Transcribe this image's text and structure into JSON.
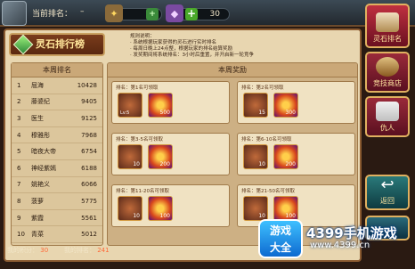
{
  "topbar": {
    "rank_label": "当前排名：",
    "rank_value": "–",
    "rank_badge": "8",
    "gems": "30"
  },
  "panel": {
    "title": "灵石排行榜",
    "rules": [
      "规则说明：",
      "· 系统根据玩家获得的灵石进行实时排名",
      "· 每周日晚上24点整，根据玩家的排名结算奖励",
      "· 发奖期间将系统排名：3小时后重置，并开启新一轮竞争"
    ],
    "left_header": "本周排名",
    "right_header": "本周奖励",
    "ranking": [
      {
        "num": "1",
        "name": "屈海",
        "score": "10428"
      },
      {
        "num": "2",
        "name": "藤婆纪",
        "score": "9405"
      },
      {
        "num": "3",
        "name": "医生",
        "score": "9125"
      },
      {
        "num": "4",
        "name": "穆雅彤",
        "score": "7968"
      },
      {
        "num": "5",
        "name": "暗夜大帝",
        "score": "6754"
      },
      {
        "num": "6",
        "name": "神经紫嫣",
        "score": "6188"
      },
      {
        "num": "7",
        "name": "姚艳义",
        "score": "6066"
      },
      {
        "num": "8",
        "name": "菠萝",
        "score": "5775"
      },
      {
        "num": "9",
        "name": "紫霞",
        "score": "5561"
      },
      {
        "num": "10",
        "name": "青菜",
        "score": "5012"
      }
    ],
    "rewards": [
      {
        "label": "排名：第1名可领取",
        "beast": "",
        "beast_lv": "Lv:5",
        "fire": "500"
      },
      {
        "label": "排名：第2名可领取",
        "beast": "15",
        "beast_lv": "",
        "fire": "300"
      },
      {
        "label": "排名：第3-5名可领取",
        "beast": "10",
        "beast_lv": "",
        "fire": "200"
      },
      {
        "label": "排名：第6-10名可领取",
        "beast": "10",
        "beast_lv": "",
        "fire": "200"
      },
      {
        "label": "排名：第11-20名可领取",
        "beast": "10",
        "beast_lv": "",
        "fire": "100"
      },
      {
        "label": "排名：第21-50名可领取",
        "beast": "10",
        "beast_lv": "",
        "fire": "100"
      }
    ],
    "my_score_label": "我的积分：",
    "my_score": "30",
    "my_rank_label": "我的排名：",
    "my_rank": "241"
  },
  "side": {
    "ranking": "灵石排名",
    "shop": "竞技商店",
    "enemy": "仇人",
    "back": "返回"
  },
  "watermark": {
    "logo_line1": "游戏",
    "logo_line2": "大全",
    "brand": "4399手机游戏",
    "url": "www.4399.cn"
  }
}
